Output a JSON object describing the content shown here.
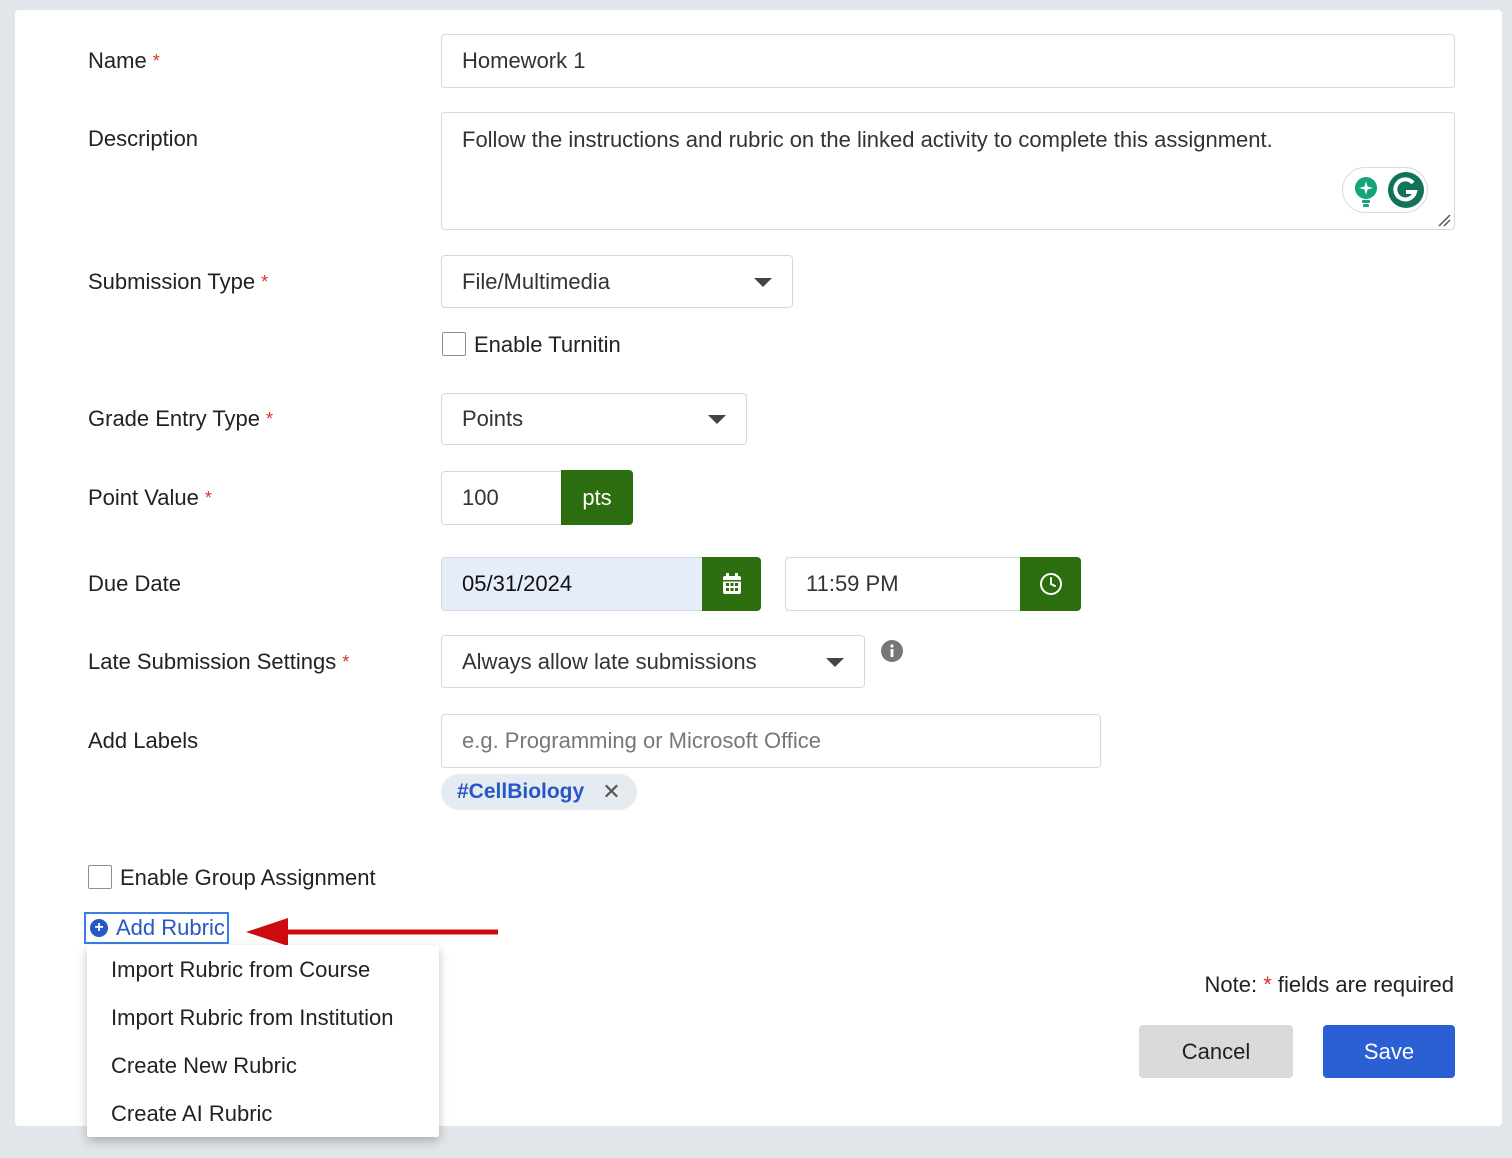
{
  "form": {
    "name_label": "Name",
    "name_value": "Homework 1",
    "description_label": "Description",
    "description_value": "Follow the instructions and rubric on the linked activity to complete this assignment.",
    "submission_type_label": "Submission Type",
    "submission_type_value": "File/Multimedia",
    "turnitin_label": "Enable Turnitin",
    "grade_entry_label": "Grade Entry Type",
    "grade_entry_value": "Points",
    "point_value_label": "Point Value",
    "point_value": "100",
    "point_unit": "pts",
    "due_date_label": "Due Date",
    "due_date_value": "05/31/2024",
    "due_time_value": "11:59 PM",
    "late_label": "Late Submission Settings",
    "late_value": "Always allow late submissions",
    "labels_label": "Add Labels",
    "labels_placeholder": "e.g. Programming or Microsoft Office",
    "labels_chip": "#CellBiology",
    "group_label": "Enable Group Assignment",
    "required_mark": "*"
  },
  "rubric": {
    "add_label": "Add Rubric",
    "menu": [
      "Import Rubric from Course",
      "Import Rubric from Institution",
      "Create New Rubric",
      "Create AI Rubric"
    ]
  },
  "footer": {
    "note_prefix": "Note:",
    "note_suffix": "fields are required",
    "cancel": "Cancel",
    "save": "Save"
  },
  "colors": {
    "accent_green": "#2c6e0f",
    "primary_blue": "#2557c7",
    "required_red": "#d9302c",
    "annotation_arrow": "#cc0a10"
  }
}
